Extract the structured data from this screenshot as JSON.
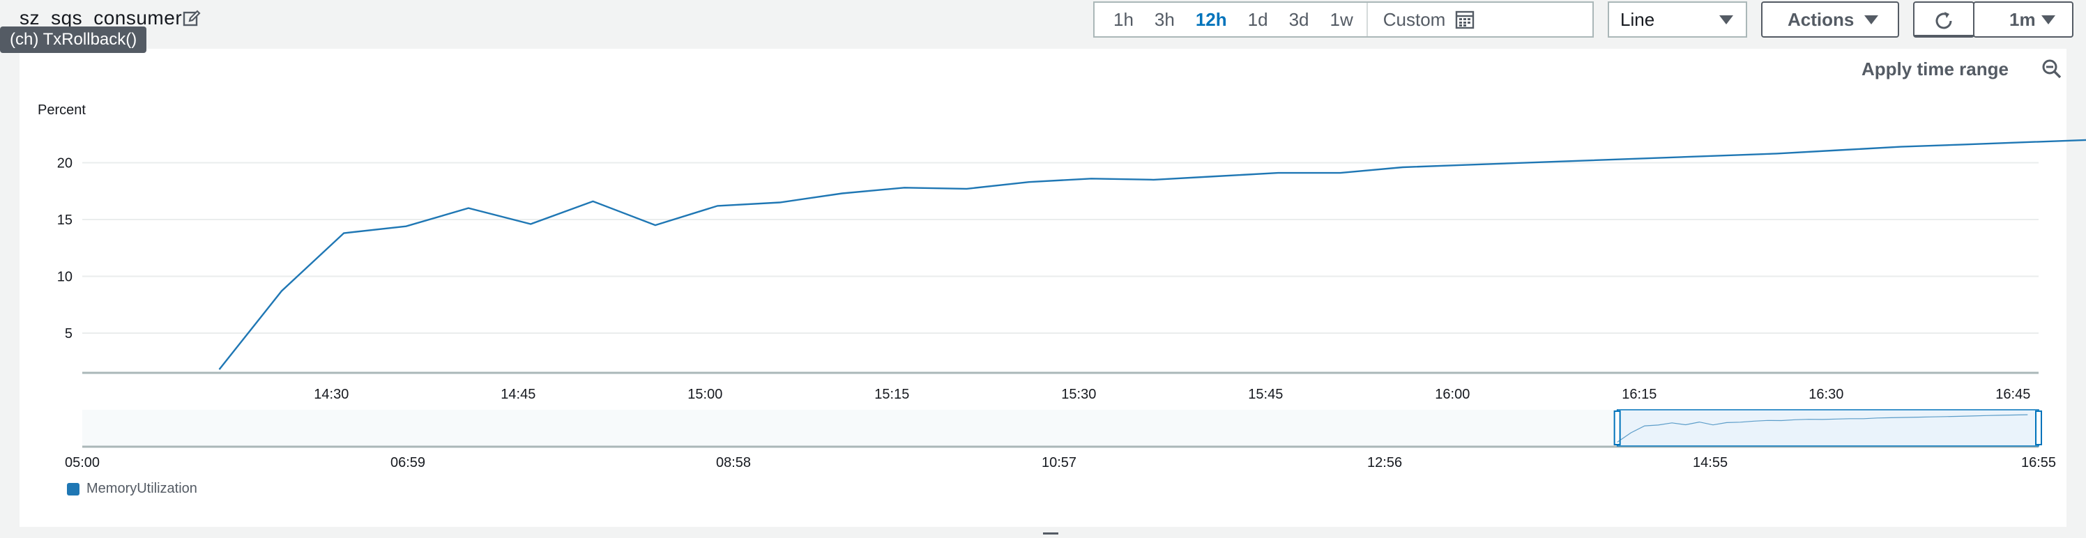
{
  "widget": {
    "title": "sz_sqs_consumer",
    "tooltip": "(ch) TxRollback()"
  },
  "toolbar": {
    "ranges": [
      "1h",
      "3h",
      "12h",
      "1d",
      "3d",
      "1w"
    ],
    "active_range": "12h",
    "custom_label": "Custom",
    "chart_type": "Line",
    "actions_label": "Actions",
    "refresh_interval": "1m"
  },
  "chart": {
    "apply_time_range": "Apply time range",
    "legend": "MemoryUtilization"
  },
  "colors": {
    "series": "#1f77b4",
    "accent": "#0073bb"
  },
  "chart_data": {
    "type": "line",
    "ylabel": "Percent",
    "ytick_labels": [
      "5",
      "10",
      "15",
      "20"
    ],
    "xtick_labels": [
      "14:30",
      "14:45",
      "15:00",
      "15:15",
      "15:30",
      "15:45",
      "16:00",
      "16:15",
      "16:30",
      "16:45"
    ],
    "series": [
      {
        "name": "MemoryUtilization",
        "x": [
          "14:21",
          "14:26",
          "14:31",
          "14:36",
          "14:41",
          "14:46",
          "14:51",
          "14:56",
          "15:01",
          "15:06",
          "15:11",
          "15:16",
          "15:21",
          "15:26",
          "15:31",
          "15:36",
          "15:41",
          "15:46",
          "15:51",
          "15:56",
          "16:01",
          "16:06",
          "16:11",
          "16:16",
          "16:21",
          "16:26",
          "16:31",
          "16:36",
          "16:41",
          "16:46",
          "16:51"
        ],
        "values": [
          1.8,
          8.7,
          13.8,
          14.4,
          16.0,
          14.6,
          16.6,
          14.5,
          16.2,
          16.5,
          17.3,
          17.8,
          17.7,
          18.3,
          18.6,
          18.5,
          18.8,
          19.1,
          19.1,
          19.6,
          19.8,
          20.0,
          20.2,
          20.4,
          20.6,
          20.8,
          21.1,
          21.4,
          21.6,
          21.8,
          22.0
        ]
      }
    ],
    "overview": {
      "xtick_labels": [
        "05:00",
        "06:59",
        "08:58",
        "10:57",
        "12:56",
        "14:55",
        "16:55"
      ],
      "selection": [
        "14:21",
        "16:55"
      ]
    }
  }
}
